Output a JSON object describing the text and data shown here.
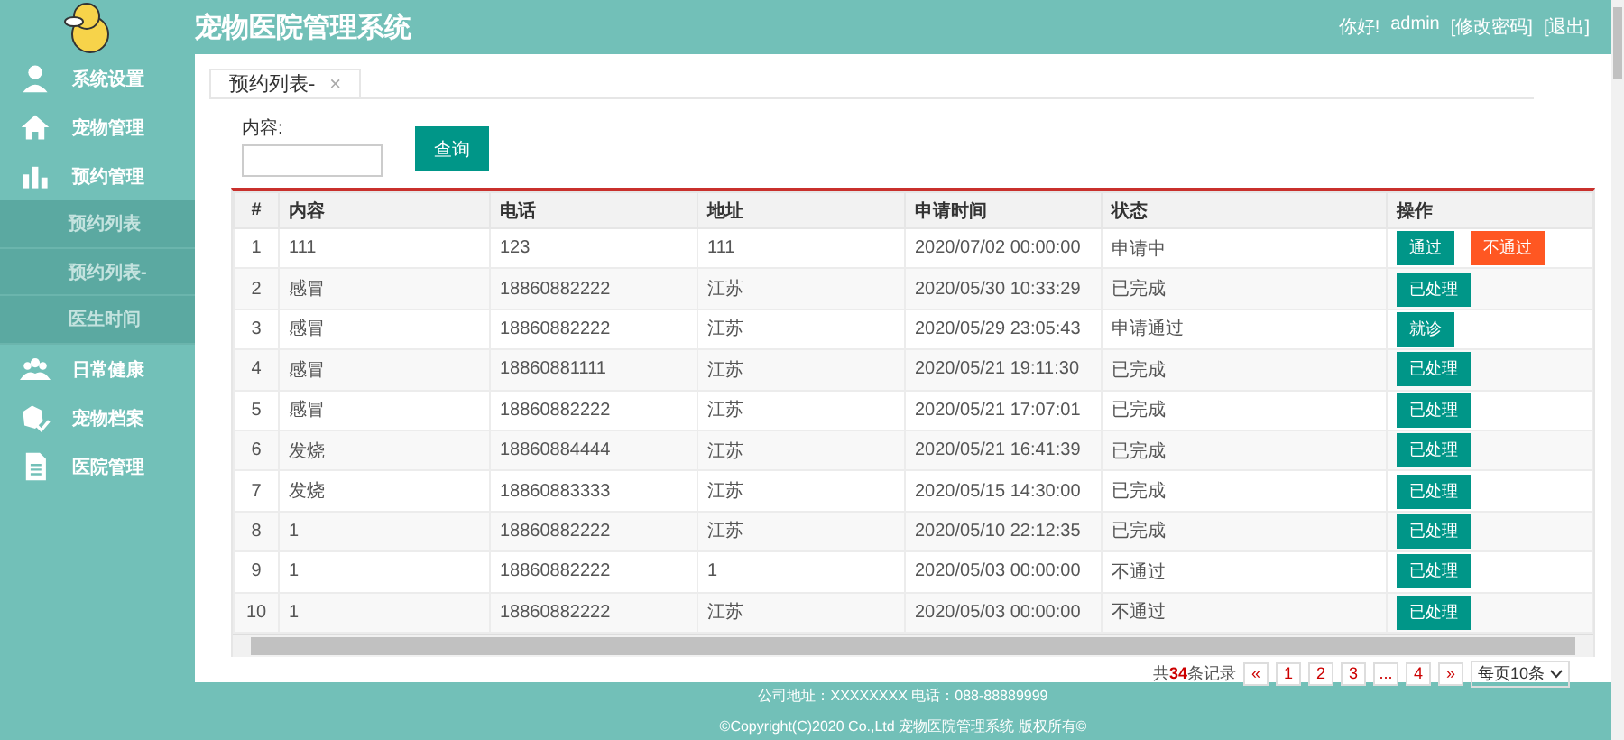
{
  "header": {
    "title": "宠物医院管理系统",
    "greeting": "你好!",
    "user": "admin",
    "links": [
      "[修改密码]",
      "[退出]"
    ]
  },
  "sidebar": {
    "items": [
      {
        "label": "系统设置"
      },
      {
        "label": "宠物管理"
      },
      {
        "label": "预约管理",
        "expanded": true,
        "children": [
          {
            "label": "预约列表"
          },
          {
            "label": "预约列表-"
          },
          {
            "label": "医生时间"
          }
        ]
      },
      {
        "label": "日常健康"
      },
      {
        "label": "宠物档案"
      },
      {
        "label": "医院管理"
      }
    ]
  },
  "tabs": [
    {
      "label": "预约列表-",
      "close": "×",
      "selected": true
    }
  ],
  "search": {
    "label": "内容:",
    "button": "查询"
  },
  "table": {
    "columns": [
      "#",
      "内容",
      "电话",
      "地址",
      "申请时间",
      "状态",
      "操作"
    ],
    "rows": [
      {
        "cells": [
          "1",
          "111",
          "123",
          "111",
          "2020/07/02 00:00:00",
          "申请中"
        ],
        "actions": [
          {
            "label": "通过",
            "kind": "approve"
          },
          {
            "label": "不通过",
            "kind": "reject"
          }
        ]
      },
      {
        "cells": [
          "2",
          "感冒",
          "18860882222",
          "江苏",
          "2020/05/30 10:33:29",
          "已完成"
        ],
        "actions": [
          {
            "label": "已处理",
            "kind": "approve"
          }
        ]
      },
      {
        "cells": [
          "3",
          "感冒",
          "18860882222",
          "江苏",
          "2020/05/29 23:05:43",
          "申请通过"
        ],
        "actions": [
          {
            "label": "就诊",
            "kind": "approve"
          }
        ]
      },
      {
        "cells": [
          "4",
          "感冒",
          "18860881111",
          "江苏",
          "2020/05/21 19:11:30",
          "已完成"
        ],
        "actions": [
          {
            "label": "已处理",
            "kind": "approve"
          }
        ]
      },
      {
        "cells": [
          "5",
          "感冒",
          "18860882222",
          "江苏",
          "2020/05/21 17:07:01",
          "已完成"
        ],
        "actions": [
          {
            "label": "已处理",
            "kind": "approve"
          }
        ]
      },
      {
        "cells": [
          "6",
          "发烧",
          "18860884444",
          "江苏",
          "2020/05/21 16:41:39",
          "已完成"
        ],
        "actions": [
          {
            "label": "已处理",
            "kind": "approve"
          }
        ]
      },
      {
        "cells": [
          "7",
          "发烧",
          "18860883333",
          "江苏",
          "2020/05/15 14:30:00",
          "已完成"
        ],
        "actions": [
          {
            "label": "已处理",
            "kind": "approve"
          }
        ]
      },
      {
        "cells": [
          "8",
          "1",
          "18860882222",
          "江苏",
          "2020/05/10 22:12:35",
          "已完成"
        ],
        "actions": [
          {
            "label": "已处理",
            "kind": "approve"
          }
        ]
      },
      {
        "cells": [
          "9",
          "1",
          "18860882222",
          "1",
          "2020/05/03 00:00:00",
          "不通过"
        ],
        "actions": [
          {
            "label": "已处理",
            "kind": "approve"
          }
        ]
      },
      {
        "cells": [
          "10",
          "1",
          "18860882222",
          "江苏",
          "2020/05/03 00:00:00",
          "不通过"
        ],
        "actions": [
          {
            "label": "已处理",
            "kind": "approve"
          }
        ]
      }
    ]
  },
  "pagination": {
    "total_prefix": "共",
    "total": "34",
    "total_suffix": "条记录",
    "pages": [
      "«",
      "1",
      "2",
      "3",
      "...",
      "4",
      "»"
    ],
    "page_size": "每页10条"
  },
  "footer": {
    "lines": [
      "公司地址：XXXXXXXX 电话：088-88889999",
      "©Copyright(C)2020 Co.,Ltd 宠物医院管理系统 版权所有©"
    ]
  }
}
